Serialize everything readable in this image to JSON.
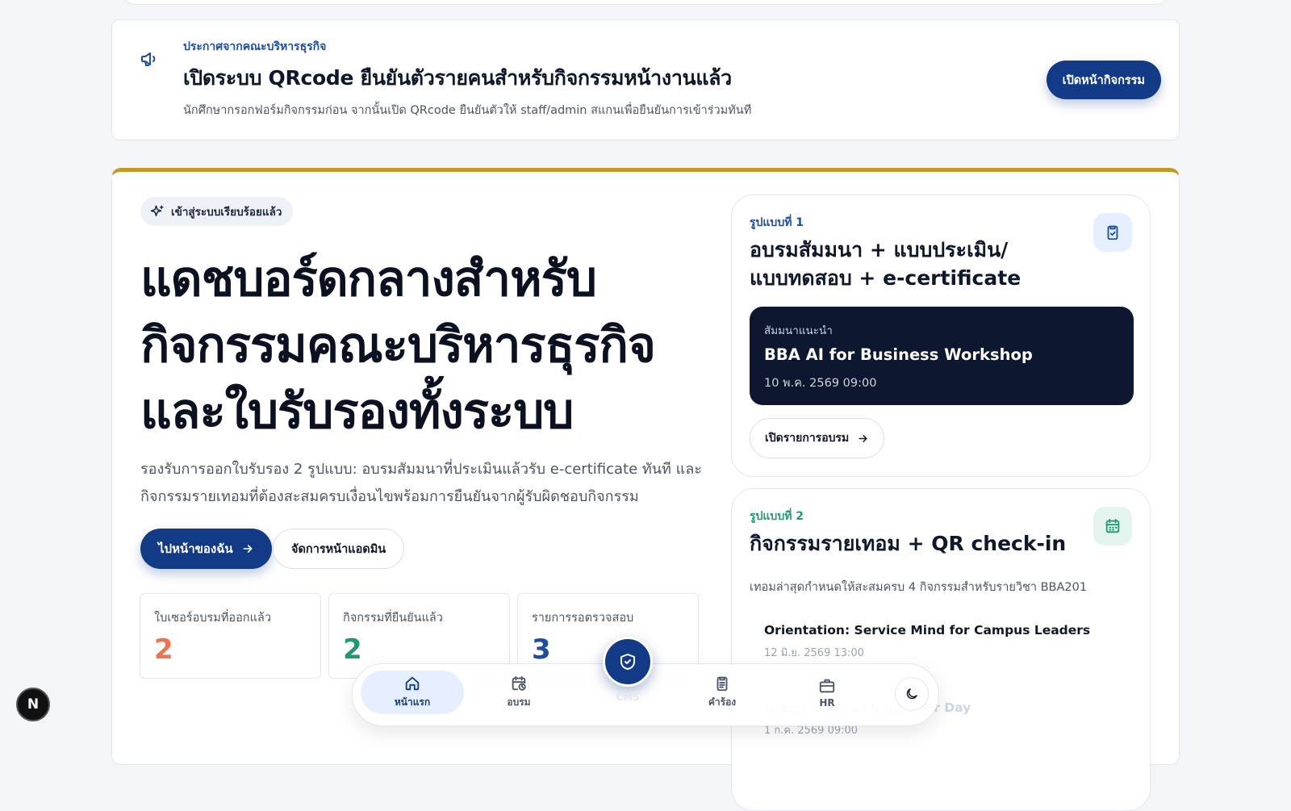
{
  "announcement": {
    "eyebrow": "ประกาศจากคณะบริหารธุรกิจ",
    "headline": "เปิดระบบ QRcode ยืนยันตัวรายคนสำหรับกิจกรรมหน้างานแล้ว",
    "description": "นักศึกษากรอกฟอร์มกิจกรรมก่อน จากนั้นเปิด QRcode ยืนยันตัวให้ staff/admin สแกนเพื่อยืนยันการเข้าร่วมทันที",
    "button": "เปิดหน้ากิจกรรม",
    "icon": "megaphone-icon"
  },
  "hero": {
    "pill": "เข้าสู่ระบบเรียบร้อยแล้ว",
    "title_lines": [
      "แดชบอร์ดกลางสำหรับ",
      "กิจกรรมคณะบริหารธุรกิจ",
      "และใบรับรองทั้งระบบ"
    ],
    "description_lines": [
      "รองรับการออกใบรับรอง 2 รูปแบบ: อบรมสัมมนาที่ประเมินแล้วรับ e-certificate ทันที และ",
      "กิจกรรมรายเทอมที่ต้องสะสมครบเงื่อนไขพร้อมการยืนยันจากผู้รับผิดชอบกิจกรรม"
    ],
    "primary_button": "ไปหน้าของฉัน",
    "secondary_button": "จัดการหน้าแอดมิน"
  },
  "stats": [
    {
      "label": "ใบเซอร์อบรมที่ออกแล้ว",
      "value": "2",
      "color": "#f07350"
    },
    {
      "label": "กิจกรรมที่ยืนยันแล้ว",
      "value": "2",
      "color": "#1f9a6e"
    },
    {
      "label": "รายการรอตรวจสอบ",
      "value": "3",
      "color": "#1e4e9c"
    }
  ],
  "mode1": {
    "eyebrow": "รูปแบบที่ 1",
    "title_lines": [
      "อบรมสัมมนา + แบบประเมิน/",
      "แบบทดสอบ + e-certificate"
    ],
    "featured": {
      "eyebrow": "สัมมนาแนะนำ",
      "title": "BBA AI for Business Workshop",
      "date": "10 พ.ค. 2569 09:00"
    },
    "button": "เปิดรายการอบรม"
  },
  "mode2": {
    "eyebrow": "รูปแบบที่ 2",
    "title": "กิจกรรมรายเทอม + QR check-in",
    "subtitle": "เทอมล่าสุดกำหนดให้สะสมครบ 4 กิจกรรมสำหรับรายวิชา BBA201",
    "items": [
      {
        "title": "Orientation: Service Mind for Campus Leaders",
        "date": "12 มิ.ย. 2569 13:00"
      },
      {
        "title": "Green Campus Volunteer Day",
        "date": "1 ก.ค. 2569 09:00"
      }
    ]
  },
  "nav": {
    "items": [
      {
        "label": "หน้าแรก",
        "icon": "home-icon"
      },
      {
        "label": "อบรม",
        "icon": "calendar-clock-icon"
      },
      {
        "label": "CMS",
        "icon": "shield-check-icon"
      },
      {
        "label": "คำร้อง",
        "icon": "clipboard-icon"
      },
      {
        "label": "HR",
        "icon": "briefcase-icon"
      }
    ]
  },
  "badge": "N",
  "colors": {
    "brand": "#123a86",
    "accent_gold": "#c49a24",
    "mode1_eyebrow": "#1e4e9c",
    "mode2_eyebrow": "#1f9a6e"
  }
}
